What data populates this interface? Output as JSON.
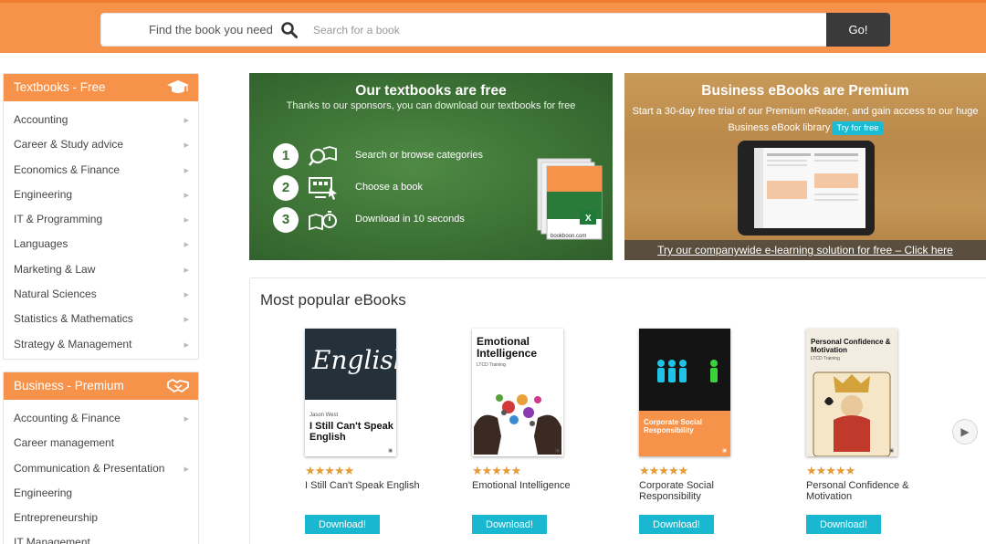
{
  "search": {
    "prompt": "Find the book you need",
    "placeholder": "Search for a book",
    "go_label": "Go!"
  },
  "sidebar_free": {
    "title": "Textbooks - Free",
    "icon": "graduation-cap-icon",
    "items": [
      {
        "label": "Accounting"
      },
      {
        "label": "Career & Study advice"
      },
      {
        "label": "Economics & Finance"
      },
      {
        "label": "Engineering"
      },
      {
        "label": "IT & Programming"
      },
      {
        "label": "Languages"
      },
      {
        "label": "Marketing & Law"
      },
      {
        "label": "Natural Sciences"
      },
      {
        "label": "Statistics & Mathematics"
      },
      {
        "label": "Strategy & Management"
      }
    ]
  },
  "sidebar_premium": {
    "title": "Business - Premium",
    "icon": "handshake-icon",
    "items": [
      {
        "label": "Accounting & Finance",
        "has_sub": true
      },
      {
        "label": "Career management",
        "has_sub": false
      },
      {
        "label": "Communication & Presentation",
        "has_sub": true
      },
      {
        "label": "Engineering",
        "has_sub": false
      },
      {
        "label": "Entrepreneurship",
        "has_sub": false
      },
      {
        "label": "IT Management",
        "has_sub": false
      }
    ]
  },
  "banner_free": {
    "title": "Our textbooks are free",
    "subtitle": "Thanks to our sponsors, you can download our textbooks for free",
    "steps": [
      {
        "num": "1",
        "text": "Search or browse categories",
        "icon": "search-book-icon"
      },
      {
        "num": "2",
        "text": "Choose a book",
        "icon": "monitor-cursor-icon"
      },
      {
        "num": "3",
        "text": "Download in 10 seconds",
        "icon": "book-timer-icon"
      }
    ],
    "cover_brand": "bookboon.com"
  },
  "banner_premium": {
    "title": "Business eBooks are Premium",
    "subtitle_line1": "Start a 30-day free trial of our Premium eReader, and gain access to our huge",
    "subtitle_line2": "Business eBook library",
    "trial_label": "Try for free",
    "footer_link": "Try our companywide e-learning solution for free – Click here"
  },
  "popular": {
    "title": "Most popular eBooks",
    "download_label": "Download!",
    "books": [
      {
        "title": "I Still Can't Speak English",
        "cover_title": "I Still Can't Speak English",
        "cover_word": "English",
        "author": "Jason West",
        "rating": "★★★★★"
      },
      {
        "title": "Emotional Intelligence",
        "cover_title": "Emotional Intelligence",
        "author": "LTCD Training",
        "rating": "★★★★★"
      },
      {
        "title": "Corporate Social Responsibility",
        "cover_title": "Corporate Social Responsibility",
        "rating": "★★★★★"
      },
      {
        "title": "Personal Confidence & Motivation",
        "cover_title": "Personal Confidence & Motivation",
        "author": "LTCD Training",
        "rating": "★★★★★"
      }
    ]
  },
  "colors": {
    "brand_orange": "#f7924a",
    "accent_cyan": "#19b7d0",
    "dark": "#3a3a3a",
    "green_board": "#3b7034"
  }
}
